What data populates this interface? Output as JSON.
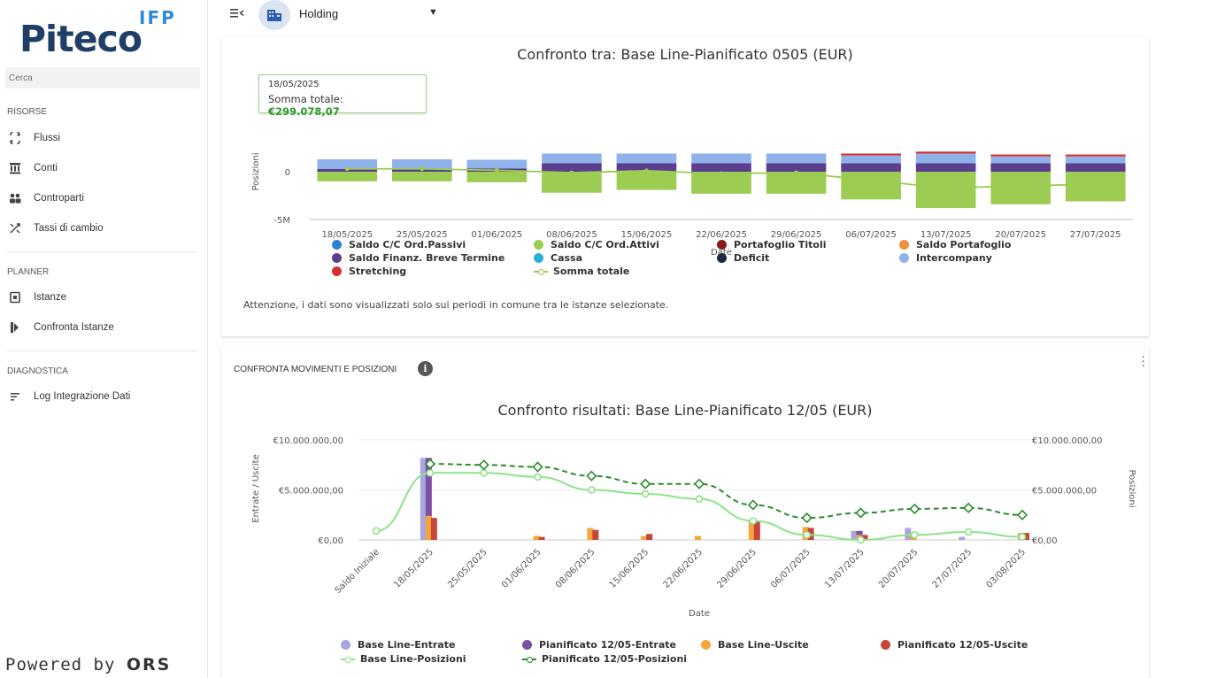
{
  "sidebar": {
    "logo_ifp": "IFP",
    "logo_brand": "Piteco",
    "search_placeholder": "Cerca",
    "sections": [
      {
        "title": "RISORSE",
        "items": [
          {
            "label": "Flussi",
            "icon": "flow-icon"
          },
          {
            "label": "Conti",
            "icon": "bank-icon"
          },
          {
            "label": "Controparti",
            "icon": "people-icon"
          },
          {
            "label": "Tassi di cambio",
            "icon": "exchange-icon"
          }
        ]
      },
      {
        "title": "PLANNER",
        "items": [
          {
            "label": "Istanze",
            "icon": "instance-icon"
          },
          {
            "label": "Confronta Istanze",
            "icon": "compare-icon"
          }
        ]
      },
      {
        "title": "DIAGNOSTICA",
        "items": [
          {
            "label": "Log Integrazione Dati",
            "icon": "list-icon"
          }
        ]
      }
    ],
    "powered_prefix": "Powered by",
    "powered_brand": "ORS"
  },
  "topbar": {
    "entity": "Holding"
  },
  "card1": {
    "tooltip_date": "18/05/2025",
    "tooltip_label": "Somma totale:",
    "tooltip_value": "€299.078,07",
    "note": "Attenzione, i dati sono visualizzati solo sui periodi in comune tra le istanze selezionate."
  },
  "card2": {
    "section_title": "CONFRONTA MOVIMENTI E POSIZIONI"
  },
  "chart_data": [
    {
      "type": "bar",
      "stacked": true,
      "title": "Confronto tra: Base Line-Pianificato 0505 (EUR)",
      "xlabel": "Date",
      "ylabel": "Posizioni",
      "y_ticks": [
        "-5M",
        "0"
      ],
      "ylim": [
        -5000000,
        2000000
      ],
      "categories": [
        "18/05/2025",
        "25/05/2025",
        "01/06/2025",
        "08/06/2025",
        "15/06/2025",
        "22/06/2025",
        "29/06/2025",
        "06/07/2025",
        "13/07/2025",
        "20/07/2025",
        "27/07/2025"
      ],
      "series": [
        {
          "name": "Saldo C/C Ord.Passivi",
          "color": "#2f7ed8",
          "values": [
            0,
            0,
            0,
            0,
            0,
            0,
            0,
            0,
            0,
            0,
            0
          ]
        },
        {
          "name": "Saldo C/C Ord.Attivi",
          "color": "#9ccc52",
          "values": [
            -1000000,
            -1000000,
            -1100000,
            -2200000,
            -1900000,
            -2300000,
            -2300000,
            -2900000,
            -3800000,
            -3400000,
            -3100000
          ]
        },
        {
          "name": "Portafoglio Titoli",
          "color": "#8b1a1a",
          "values": [
            0,
            0,
            0,
            0,
            0,
            0,
            0,
            0,
            0,
            0,
            0
          ]
        },
        {
          "name": "Saldo Portafoglio",
          "color": "#f0923a",
          "values": [
            0,
            0,
            0,
            0,
            0,
            0,
            0,
            0,
            0,
            0,
            0
          ]
        },
        {
          "name": "Saldo Finanz. Breve Termine",
          "color": "#5b3f8e",
          "values": [
            300000,
            300000,
            350000,
            900000,
            900000,
            900000,
            900000,
            900000,
            900000,
            900000,
            900000
          ]
        },
        {
          "name": "Cassa",
          "color": "#2ab0d8",
          "values": [
            0,
            0,
            0,
            0,
            0,
            0,
            0,
            0,
            0,
            0,
            0
          ]
        },
        {
          "name": "Deficit",
          "color": "#1c2a44",
          "values": [
            0,
            0,
            0,
            0,
            0,
            0,
            0,
            0,
            0,
            0,
            0
          ]
        },
        {
          "name": "Intercompany",
          "color": "#8fb2ea",
          "values": [
            1000000,
            1000000,
            900000,
            1000000,
            1000000,
            1000000,
            1000000,
            800000,
            1000000,
            700000,
            700000
          ]
        },
        {
          "name": "Stretching",
          "color": "#d62f2f",
          "values": [
            0,
            0,
            0,
            0,
            0,
            0,
            0,
            200000,
            200000,
            200000,
            200000
          ]
        }
      ],
      "line": {
        "name": "Somma totale",
        "color": "#9ccc52",
        "values": [
          299078.07,
          300000,
          150000,
          -100000,
          100000,
          -200000,
          -100000,
          -900000,
          -1700000,
          -1500000,
          -1300000
        ]
      }
    },
    {
      "type": "bar",
      "title": "Confronto risultati: Base Line-Pianificato 12/05 (EUR)",
      "xlabel": "Date",
      "ylabel": "Entrate / Uscite",
      "ylabel_right": "Posizioni",
      "y_ticks": [
        "€0,00",
        "€5.000.000,00",
        "€10.000.000,00"
      ],
      "ylim": [
        0,
        10000000
      ],
      "categories": [
        "Saldo Iniziale",
        "18/05/2025",
        "25/05/2025",
        "01/06/2025",
        "08/06/2025",
        "15/06/2025",
        "22/06/2025",
        "29/06/2025",
        "06/07/2025",
        "13/07/2025",
        "20/07/2025",
        "27/07/2025",
        "03/08/2025"
      ],
      "series": [
        {
          "name": "Base Line-Entrate",
          "color": "#a9a6e0",
          "kind": "bar",
          "values": [
            0,
            8200000,
            0,
            0,
            0,
            0,
            0,
            0,
            0,
            900000,
            1200000,
            300000,
            0
          ]
        },
        {
          "name": "Pianificato 12/05-Entrate",
          "color": "#7b4fa2",
          "kind": "bar",
          "values": [
            0,
            8200000,
            0,
            0,
            0,
            0,
            0,
            0,
            0,
            900000,
            600000,
            0,
            0
          ]
        },
        {
          "name": "Base Line-Uscite",
          "color": "#f7a43d",
          "kind": "bar",
          "values": [
            0,
            2400000,
            0,
            400000,
            1200000,
            400000,
            400000,
            2000000,
            1300000,
            500000,
            700000,
            0,
            700000
          ]
        },
        {
          "name": "Pianificato 12/05-Uscite",
          "color": "#c8453b",
          "kind": "bar",
          "values": [
            0,
            2200000,
            0,
            300000,
            1000000,
            600000,
            0,
            1800000,
            1200000,
            500000,
            0,
            0,
            700000
          ]
        },
        {
          "name": "Base Line-Posizioni",
          "color": "#8ee38a",
          "kind": "line",
          "values": [
            900000,
            6700000,
            6700000,
            6300000,
            5000000,
            4600000,
            4100000,
            1900000,
            500000,
            0,
            500000,
            800000,
            300000
          ]
        },
        {
          "name": "Pianificato 12/05-Posizioni",
          "color": "#2e8b2e",
          "kind": "line-dashed",
          "values": [
            null,
            7600000,
            7500000,
            7300000,
            6400000,
            5600000,
            5600000,
            3500000,
            2200000,
            2700000,
            3100000,
            3200000,
            2500000
          ]
        }
      ]
    }
  ]
}
